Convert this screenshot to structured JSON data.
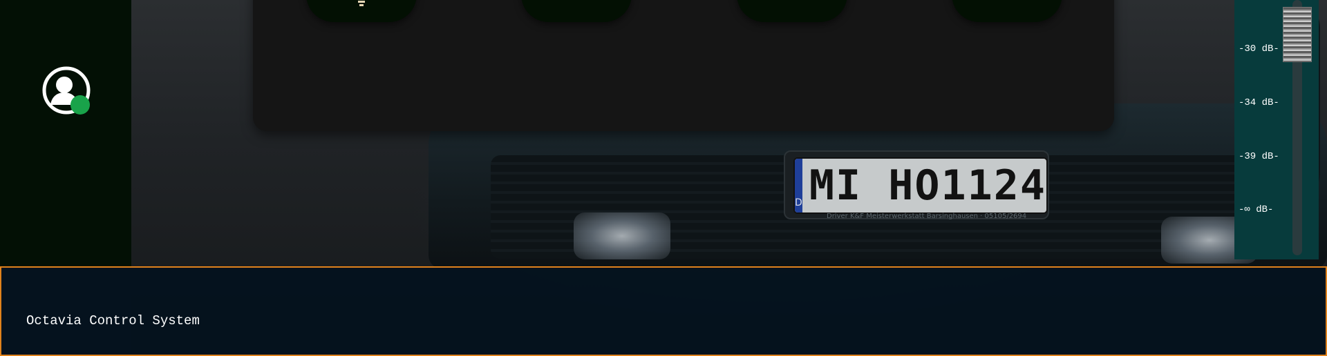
{
  "app": {
    "title": "Octavia Control System"
  },
  "background": {
    "plate_country": "D",
    "plate_text": "MI HO1124",
    "plate_caption": "Driver   K&F Meisterwerkstatt Barsinghausen  ·  05105/2694"
  },
  "sidebar": {
    "avatar_icon": "user-avatar-icon",
    "status": "online",
    "status_color": "#19a34a"
  },
  "toolbar": {
    "tiles": [
      {
        "icon": "light-bulb-icon"
      },
      {
        "icon": "car-settings-icon"
      },
      {
        "icon": "engine-icon"
      },
      {
        "icon": "blank-tile"
      }
    ]
  },
  "volume_meter": {
    "labels": [
      "-30 dB-",
      "-34 dB-",
      "-39 dB-",
      "-∞ dB-"
    ],
    "level_fraction": 0.95
  },
  "colors": {
    "accent_border": "#e1821c",
    "meter_bg": "#073b3c",
    "sidebar_bg": "#031005"
  }
}
